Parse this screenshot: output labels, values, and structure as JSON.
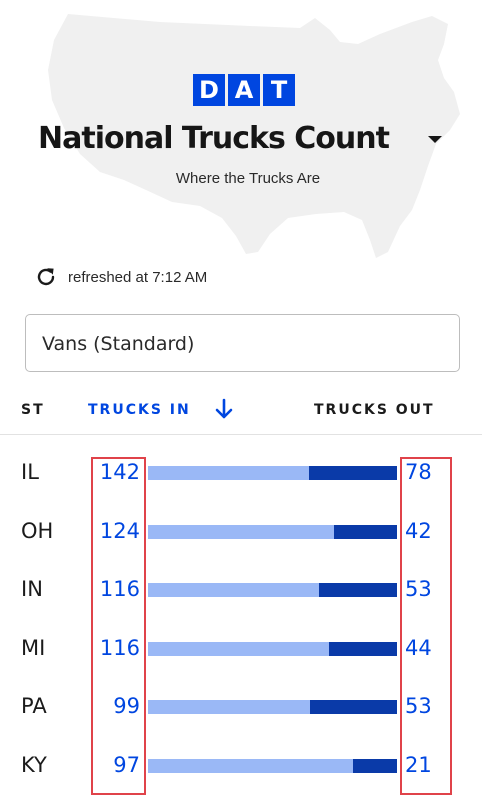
{
  "logo": {
    "letters": [
      "D",
      "A",
      "T"
    ]
  },
  "header": {
    "title": "National Trucks Count",
    "subtitle": "Where the Trucks Are"
  },
  "refresh": {
    "text": "refreshed at 7:12 AM"
  },
  "equipment_select": {
    "value": "Vans (Standard)"
  },
  "table": {
    "columns": {
      "state": "ST",
      "trucks_in": "TRUCKS IN",
      "trucks_out": "TRUCKS OUT"
    },
    "sort": {
      "column": "trucks_in",
      "direction": "descending"
    },
    "rows": [
      {
        "state": "IL",
        "trucks_in": "142",
        "trucks_out": "78"
      },
      {
        "state": "OH",
        "trucks_in": "124",
        "trucks_out": "42"
      },
      {
        "state": "IN",
        "trucks_in": "116",
        "trucks_out": "53"
      },
      {
        "state": "MI",
        "trucks_in": "116",
        "trucks_out": "44"
      },
      {
        "state": "PA",
        "trucks_in": "99",
        "trucks_out": "53"
      },
      {
        "state": "KY",
        "trucks_in": "97",
        "trucks_out": "21"
      }
    ]
  },
  "colors": {
    "brand_blue": "#0046e0",
    "bar_in": "#9ab8f6",
    "bar_out": "#0a3aa8",
    "highlight": "#e0434a",
    "map": "#f0f0f0"
  },
  "icons": {
    "refresh": "refresh-icon",
    "sort": "arrow-down-icon",
    "dropdown": "caret-down-icon",
    "map": "usa-map-icon"
  }
}
